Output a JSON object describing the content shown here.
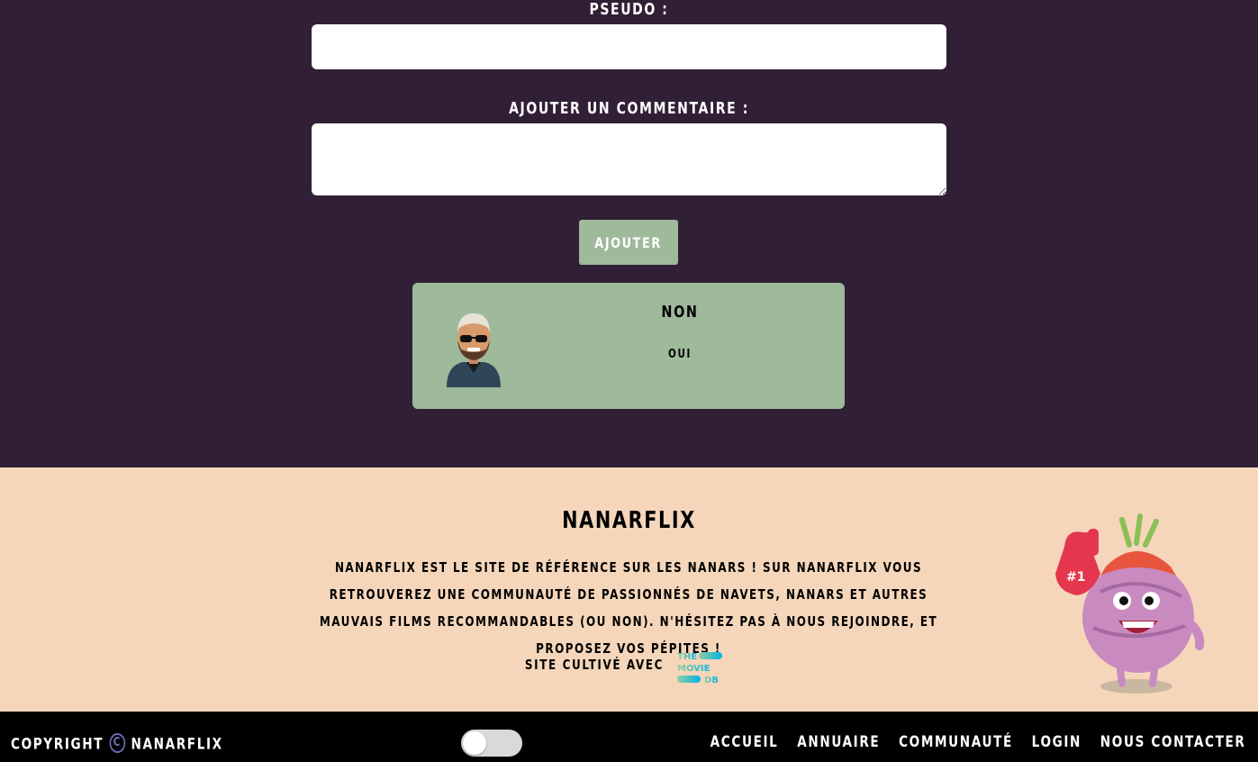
{
  "form": {
    "pseudo_label": "PSEUDO :",
    "pseudo_value": "",
    "comment_label": "AJOUTER UN COMMENTAIRE :",
    "comment_value": "",
    "submit_label": "AJOUTER"
  },
  "comments": [
    {
      "avatar_icon": "bearded-man-sunglasses-avatar",
      "pseudo": "NON",
      "text": "OUI"
    }
  ],
  "footer": {
    "title": "NANARFLIX",
    "description": "NANARFLIX EST LE SITE DE RÉFÉRENCE SUR LES NANARS ! SUR NANARFLIX VOUS RETROUVEREZ UNE COMMUNAUTÉ DE PASSIONNÉS DE NAVETS, NANARS ET AUTRES MAUVAIS FILMS RECOMMANDABLES (OU NON). N'HÉSITEZ PAS À NOUS REJOINDRE, ET PROPOSEZ VOS PÉPITES !",
    "cultive_label": "SITE CULTIVÉ AVEC",
    "tmdb_logo": {
      "line1": "THE",
      "line2": "MOVIE",
      "line3": "DB"
    }
  },
  "bottom_bar": {
    "copyright_prefix": "COPYRIGHT",
    "copyright_symbol": "C",
    "copyright_name": "NANARFLIX",
    "nav": [
      "ACCUEIL",
      "ANNUAIRE",
      "COMMUNAUTÉ",
      "LOGIN",
      "NOUS CONTACTER"
    ]
  },
  "colors": {
    "background": "#311f36",
    "accent_green": "#9fb99b",
    "footer_bg": "#f5d6bb",
    "bottom_bg": "#000000"
  }
}
